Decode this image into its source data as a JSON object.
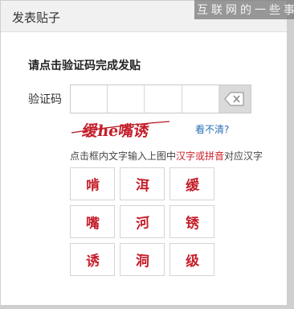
{
  "modal": {
    "title": "发表贴子",
    "heading": "请点击验证码完成发贴"
  },
  "watermark": "互联网的一些事",
  "captcha": {
    "label": "验证码",
    "image_text": "缓he嘴诱",
    "refresh_link": "看不清?",
    "hint_prefix": "点击框内文字输入上图中",
    "hint_highlight": "汉字或拼音",
    "hint_suffix": "对应汉字",
    "accent_color": "#d0202a",
    "choices": [
      "啃",
      "洱",
      "缓",
      "嘴",
      "河",
      "锈",
      "诱",
      "洞",
      "级"
    ]
  }
}
